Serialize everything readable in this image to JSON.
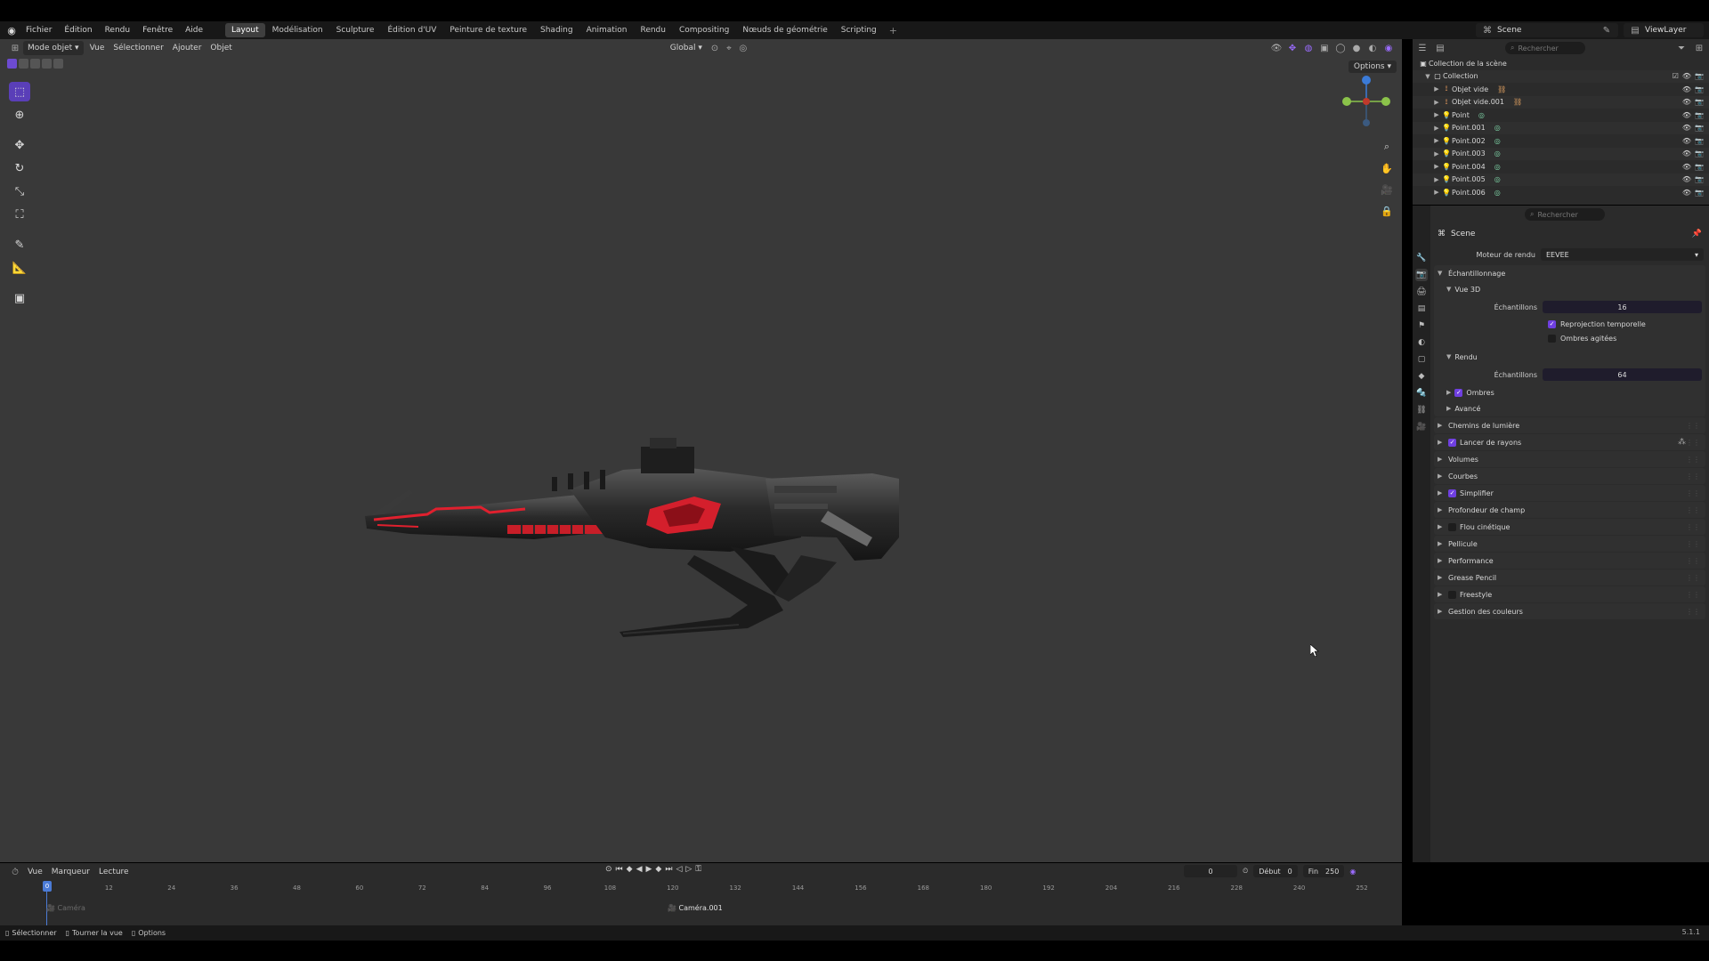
{
  "topbar": {
    "menu": [
      "Fichier",
      "Édition",
      "Rendu",
      "Fenêtre",
      "Aide"
    ],
    "workspaces": [
      "Layout",
      "Modélisation",
      "Sculpture",
      "Édition d'UV",
      "Peinture de texture",
      "Shading",
      "Animation",
      "Rendu",
      "Compositing",
      "Nœuds de géométrie",
      "Scripting"
    ],
    "active_workspace": "Layout",
    "scene_name": "Scene",
    "view_layer": "ViewLayer"
  },
  "viewport": {
    "mode": "Mode objet",
    "menus": [
      "Vue",
      "Sélectionner",
      "Ajouter",
      "Objet"
    ],
    "transform_orientation": "Global",
    "options_label": "Options"
  },
  "outliner": {
    "search_placeholder": "Rechercher",
    "scene_collection": "Collection de la scène",
    "collection": "Collection",
    "items": [
      {
        "name": "Objet vide",
        "type": "empty"
      },
      {
        "name": "Objet vide.001",
        "type": "empty"
      },
      {
        "name": "Point",
        "type": "light"
      },
      {
        "name": "Point.001",
        "type": "light"
      },
      {
        "name": "Point.002",
        "type": "light"
      },
      {
        "name": "Point.003",
        "type": "light"
      },
      {
        "name": "Point.004",
        "type": "light"
      },
      {
        "name": "Point.005",
        "type": "light"
      },
      {
        "name": "Point.006",
        "type": "light"
      }
    ]
  },
  "properties": {
    "search_placeholder": "Rechercher",
    "scene_label": "Scene",
    "render_engine_label": "Moteur de rendu",
    "render_engine_value": "EEVEE",
    "sampling": {
      "title": "Échantillonnage",
      "viewport_title": "Vue 3D",
      "viewport_samples_label": "Échantillons",
      "viewport_samples": "16",
      "temporal_reprojection": "Reprojection temporelle",
      "jittered_shadows": "Ombres agitées",
      "render_title": "Rendu",
      "render_samples_label": "Échantillons",
      "render_samples": "64",
      "shadows": "Ombres",
      "advanced": "Avancé"
    },
    "panels": [
      {
        "label": "Chemins de lumière",
        "checkbox": "none"
      },
      {
        "label": "Lancer de rayons",
        "checkbox": "on"
      },
      {
        "label": "Volumes",
        "checkbox": "none"
      },
      {
        "label": "Courbes",
        "checkbox": "none"
      },
      {
        "label": "Simplifier",
        "checkbox": "on"
      },
      {
        "label": "Profondeur de champ",
        "checkbox": "none"
      },
      {
        "label": "Flou cinétique",
        "checkbox": "off"
      },
      {
        "label": "Pellicule",
        "checkbox": "none"
      },
      {
        "label": "Performance",
        "checkbox": "none"
      },
      {
        "label": "Grease Pencil",
        "checkbox": "none"
      },
      {
        "label": "Freestyle",
        "checkbox": "off"
      },
      {
        "label": "Gestion des couleurs",
        "checkbox": "none"
      }
    ]
  },
  "timeline": {
    "menus": [
      "Vue",
      "Marqueur",
      "Lecture"
    ],
    "current_frame": "0",
    "start_label": "Début",
    "start_value": "0",
    "end_label": "Fin",
    "end_value": "250",
    "ruler": [
      "0",
      "12",
      "24",
      "36",
      "48",
      "60",
      "72",
      "84",
      "96",
      "108",
      "120",
      "132",
      "144",
      "156",
      "168",
      "180",
      "192",
      "204",
      "216",
      "228",
      "240",
      "252"
    ],
    "markers": [
      {
        "label": "Caméra",
        "dim": true
      },
      {
        "label": "Caméra.001",
        "dim": false
      }
    ]
  },
  "statusbar": {
    "select": "Sélectionner",
    "rotate": "Tourner la vue",
    "options": "Options",
    "version": "5.1.1"
  },
  "colors": {
    "accent": "#6f3fe0",
    "viewport_bg": "#393939",
    "panel_bg": "#2b2b2b",
    "weapon_red": "#e0202e"
  }
}
